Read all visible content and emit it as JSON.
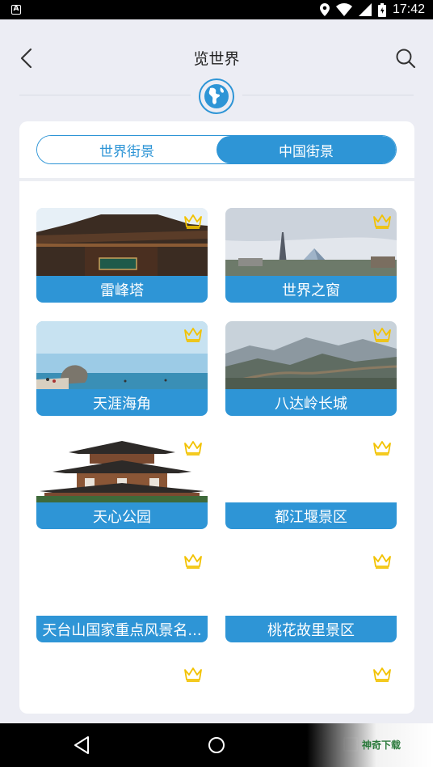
{
  "status_bar": {
    "time": "17:42",
    "left_icon": "A"
  },
  "header": {
    "title": "览世界",
    "back_icon": "chevron-left-icon",
    "search_icon": "search-icon",
    "emblem_icon": "globe-icon"
  },
  "tabs": [
    {
      "label": "世界街景",
      "active": false
    },
    {
      "label": "中国街景",
      "active": true
    }
  ],
  "places": [
    {
      "name": "雷峰塔",
      "premium": true,
      "image": "pagoda-photo"
    },
    {
      "name": "世界之窗",
      "premium": true,
      "image": "eiffel-pyramid-photo"
    },
    {
      "name": "天涯海角",
      "premium": true,
      "image": "beach-photo"
    },
    {
      "name": "八达岭长城",
      "premium": true,
      "image": "great-wall-photo"
    },
    {
      "name": "天心公园",
      "premium": true,
      "image": "pavilion-photo"
    },
    {
      "name": "都江堰景区",
      "premium": true,
      "image": ""
    },
    {
      "name": "天台山国家重点风景名...",
      "premium": true,
      "image": ""
    },
    {
      "name": "桃花故里景区",
      "premium": true,
      "image": ""
    },
    {
      "name": "",
      "premium": true,
      "image": ""
    },
    {
      "name": "",
      "premium": true,
      "image": ""
    }
  ],
  "watermark": "神奇下载",
  "colors": {
    "accent": "#2e95d6",
    "crown": "#f2c200",
    "background": "#ecedf4"
  }
}
